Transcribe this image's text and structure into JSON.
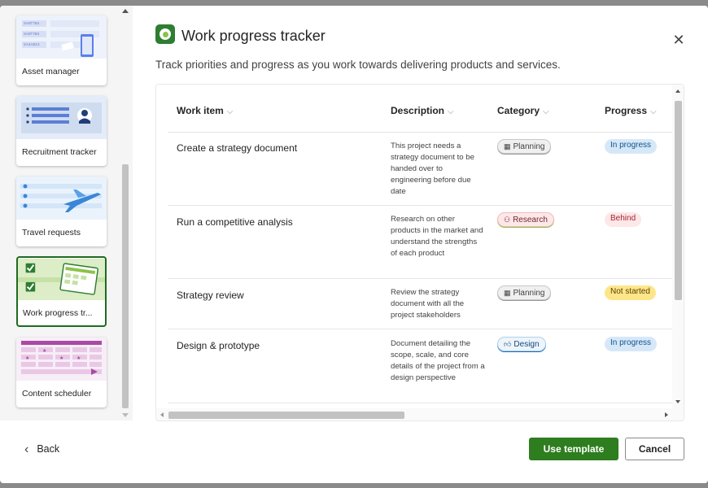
{
  "templates": [
    {
      "label": "Asset manager",
      "selected": false,
      "mini_rows": [
        "SA8T7B4",
        "SA8T7B4",
        "SA4AB13"
      ]
    },
    {
      "label": "Recruitment tracker",
      "selected": false
    },
    {
      "label": "Travel requests",
      "selected": false
    },
    {
      "label": "Work progress tr...",
      "selected": true
    },
    {
      "label": "Content scheduler",
      "selected": false
    }
  ],
  "header": {
    "title": "Work progress tracker",
    "description": "Track priorities and progress as you work towards delivering products and services."
  },
  "table": {
    "columns": [
      "Work item",
      "Description",
      "Category",
      "Progress"
    ],
    "rows": [
      {
        "work_item": "Create a strategy document",
        "description": "This project needs a strategy document to be handed over to engineering before due date",
        "category": "Planning",
        "category_icon": "calendar-icon",
        "progress": "In progress"
      },
      {
        "work_item": "Run a competitive analysis",
        "description": "Research on other products in the market and understand the strengths of each product",
        "category": "Research",
        "category_icon": "people-icon",
        "progress": "Behind"
      },
      {
        "work_item": "Strategy review",
        "description": "Review the strategy document with all the project stakeholders",
        "category": "Planning",
        "category_icon": "calendar-icon",
        "progress": "Not started"
      },
      {
        "work_item": "Design & prototype",
        "description": "Document detailing the scope, scale, and core details of the project from a design perspective",
        "category": "Design",
        "category_icon": "thumbs-up-icon",
        "progress": "In progress"
      }
    ]
  },
  "footer": {
    "back_label": "Back",
    "use_template_label": "Use template",
    "cancel_label": "Cancel"
  },
  "colors": {
    "primary_button": "#2e7d1f",
    "in_progress": "#d6e8f8",
    "behind": "#fde7e9",
    "not_started": "#fde68a"
  }
}
